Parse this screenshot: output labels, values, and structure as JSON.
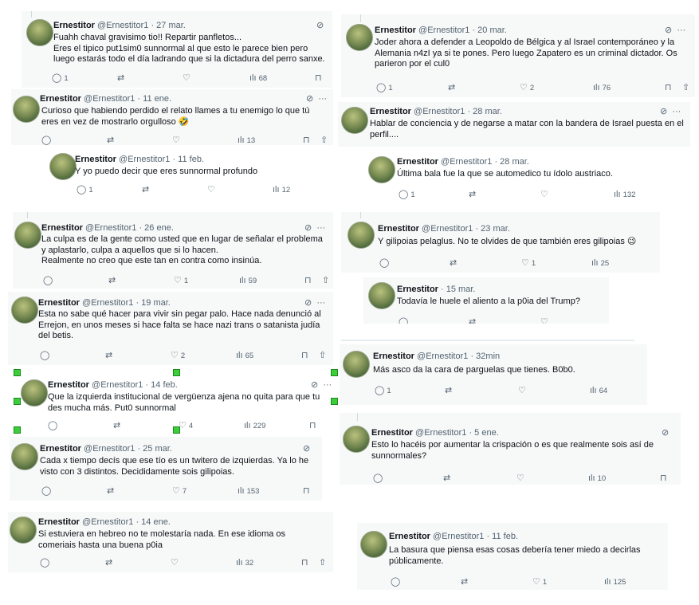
{
  "icons": {
    "reply": "reply-icon",
    "retweet": "retweet-icon",
    "like": "heart-icon",
    "views": "views-icon",
    "bookmark": "bookmark-icon",
    "share": "share-icon",
    "grok": "grok-icon",
    "more": "more-icon"
  },
  "colors": {
    "card_bg": "#f7f8f8",
    "muted": "#536471",
    "selection": "#3ccc3c"
  },
  "tweets": [
    {
      "name": "Ernestitor",
      "handle": "@Ernestitor1",
      "time": "· 27 mar.",
      "text": "Fuahh chaval gravisimo tio!! Repartir panfletos...\nEres el tipico put1sim0 sunnormal al que esto le parece bien pero luego estarás todo el día ladrando que si la dictadura del perro sanxe.",
      "replies": "1",
      "likes": "",
      "views": "68"
    },
    {
      "name": "Ernestitor",
      "handle": "@Ernestitor1",
      "time": "· 11 ene.",
      "text": "Curioso que habiendo perdido el relato llames a tu enemigo lo que tú eres en vez de mostrarlo orgulloso 🤣",
      "replies": "",
      "likes": "",
      "views": "13"
    },
    {
      "name": "Ernestitor",
      "handle": "@Ernestitor1",
      "time": "· 11 feb.",
      "text": "Y yo puedo decir que eres sunnormal profundo",
      "replies": "1",
      "likes": "",
      "views": "12"
    },
    {
      "name": "Ernestitor",
      "handle": "@Ernestitor1",
      "time": "· 26 ene.",
      "text": "La culpa es de la gente como usted que en lugar de señalar el problema y aplastarlo, culpa a aquellos que si lo hacen.\nRealmente no creo que este tan en contra como insinúa.",
      "replies": "",
      "likes": "1",
      "views": "59"
    },
    {
      "name": "Ernestitor",
      "handle": "@Ernestitor1",
      "time": "· 19 mar.",
      "text": "Esta no sabe qué hacer para vivir sin pegar palo. Hace nada denunció al Errejon, en unos meses si hace falta se hace nazi trans o satanista judía del betis.",
      "replies": "",
      "likes": "2",
      "views": "65"
    },
    {
      "name": "Ernestitor",
      "handle": "@Ernestitor1",
      "time": "· 14 feb.",
      "text": "Que la izquierda institucional de vergüenza ajena no quita para que tu des mucha más.  Put0 sunnormal",
      "replies": "",
      "likes": "4",
      "views": "229"
    },
    {
      "name": "Ernestitor",
      "handle": "@Ernestitor1",
      "time": "· 25 mar.",
      "text": "Cada x tiempo decís que ese tío es un twitero de izquierdas. Ya lo he visto con 3 distintos. Decididamente sois gilipoias.",
      "replies": "",
      "likes": "7",
      "views": "153"
    },
    {
      "name": "Ernestitor",
      "handle": "@Ernestitor1",
      "time": "· 14 ene.",
      "text": "Si estuviera en hebreo no te molestaría nada. En ese idioma os comeriais hasta una buena p0ia",
      "replies": "",
      "likes": "",
      "views": "32"
    },
    {
      "name": "Ernestitor",
      "handle": "@Ernestitor1",
      "time": "· 20 mar.",
      "text": "Joder ahora a defender a Leopoldo de Bélgica y al Israel contemporáneo y la Alemania n4zI ya si te pones. Pero luego Zapatero es un criminal dictador. Os parieron por el cul0",
      "replies": "1",
      "likes": "2",
      "views": "76"
    },
    {
      "name": "Ernestitor",
      "handle": "@Ernestitor1",
      "time": "· 28 mar.",
      "text": "Hablar de conciencia y de negarse a matar con la bandera de Israel puesta en el perfil....",
      "replies": "",
      "likes": "",
      "views": ""
    },
    {
      "name": "Ernestitor",
      "handle": "@Ernestitor1",
      "time": "· 28 mar.",
      "text": "Última bala fue la que se automedico tu ídolo austriaco.",
      "replies": "1",
      "likes": "",
      "views": "132"
    },
    {
      "name": "Ernestitor",
      "handle": "@Ernestitor1",
      "time": "· 23 mar.",
      "text": "Y gilipoias pelaglus. No te olvides de que también eres gilipoias 😉",
      "replies": "",
      "likes": "1",
      "views": "25"
    },
    {
      "name": "Ernestitor",
      "handle": "@Ernestitor1",
      "time": "· 15 mar.",
      "text": "Todavía le huele el aliento a la p0ia del Trump?",
      "replies": "",
      "likes": "",
      "views": ""
    },
    {
      "name": "Ernestitor",
      "handle": "@Ernestitor1",
      "time": "· 32min",
      "text": "Más asco da la cara de parguelas que tienes. B0b0.",
      "replies": "1",
      "likes": "",
      "views": "64"
    },
    {
      "name": "Ernestitor",
      "handle": "@Ernestitor1",
      "time": "· 5 ene.",
      "text": "Esto lo hacéis por aumentar la crispación o es que realmente sois así de sunnormales?",
      "replies": "",
      "likes": "",
      "views": "10"
    },
    {
      "name": "Ernestitor",
      "handle": "@Ernestitor1",
      "time": "· 11 feb.",
      "text": "La basura que piensa esas cosas debería tener miedo a decirlas públicamente.",
      "replies": "",
      "likes": "1",
      "views": "125"
    }
  ]
}
